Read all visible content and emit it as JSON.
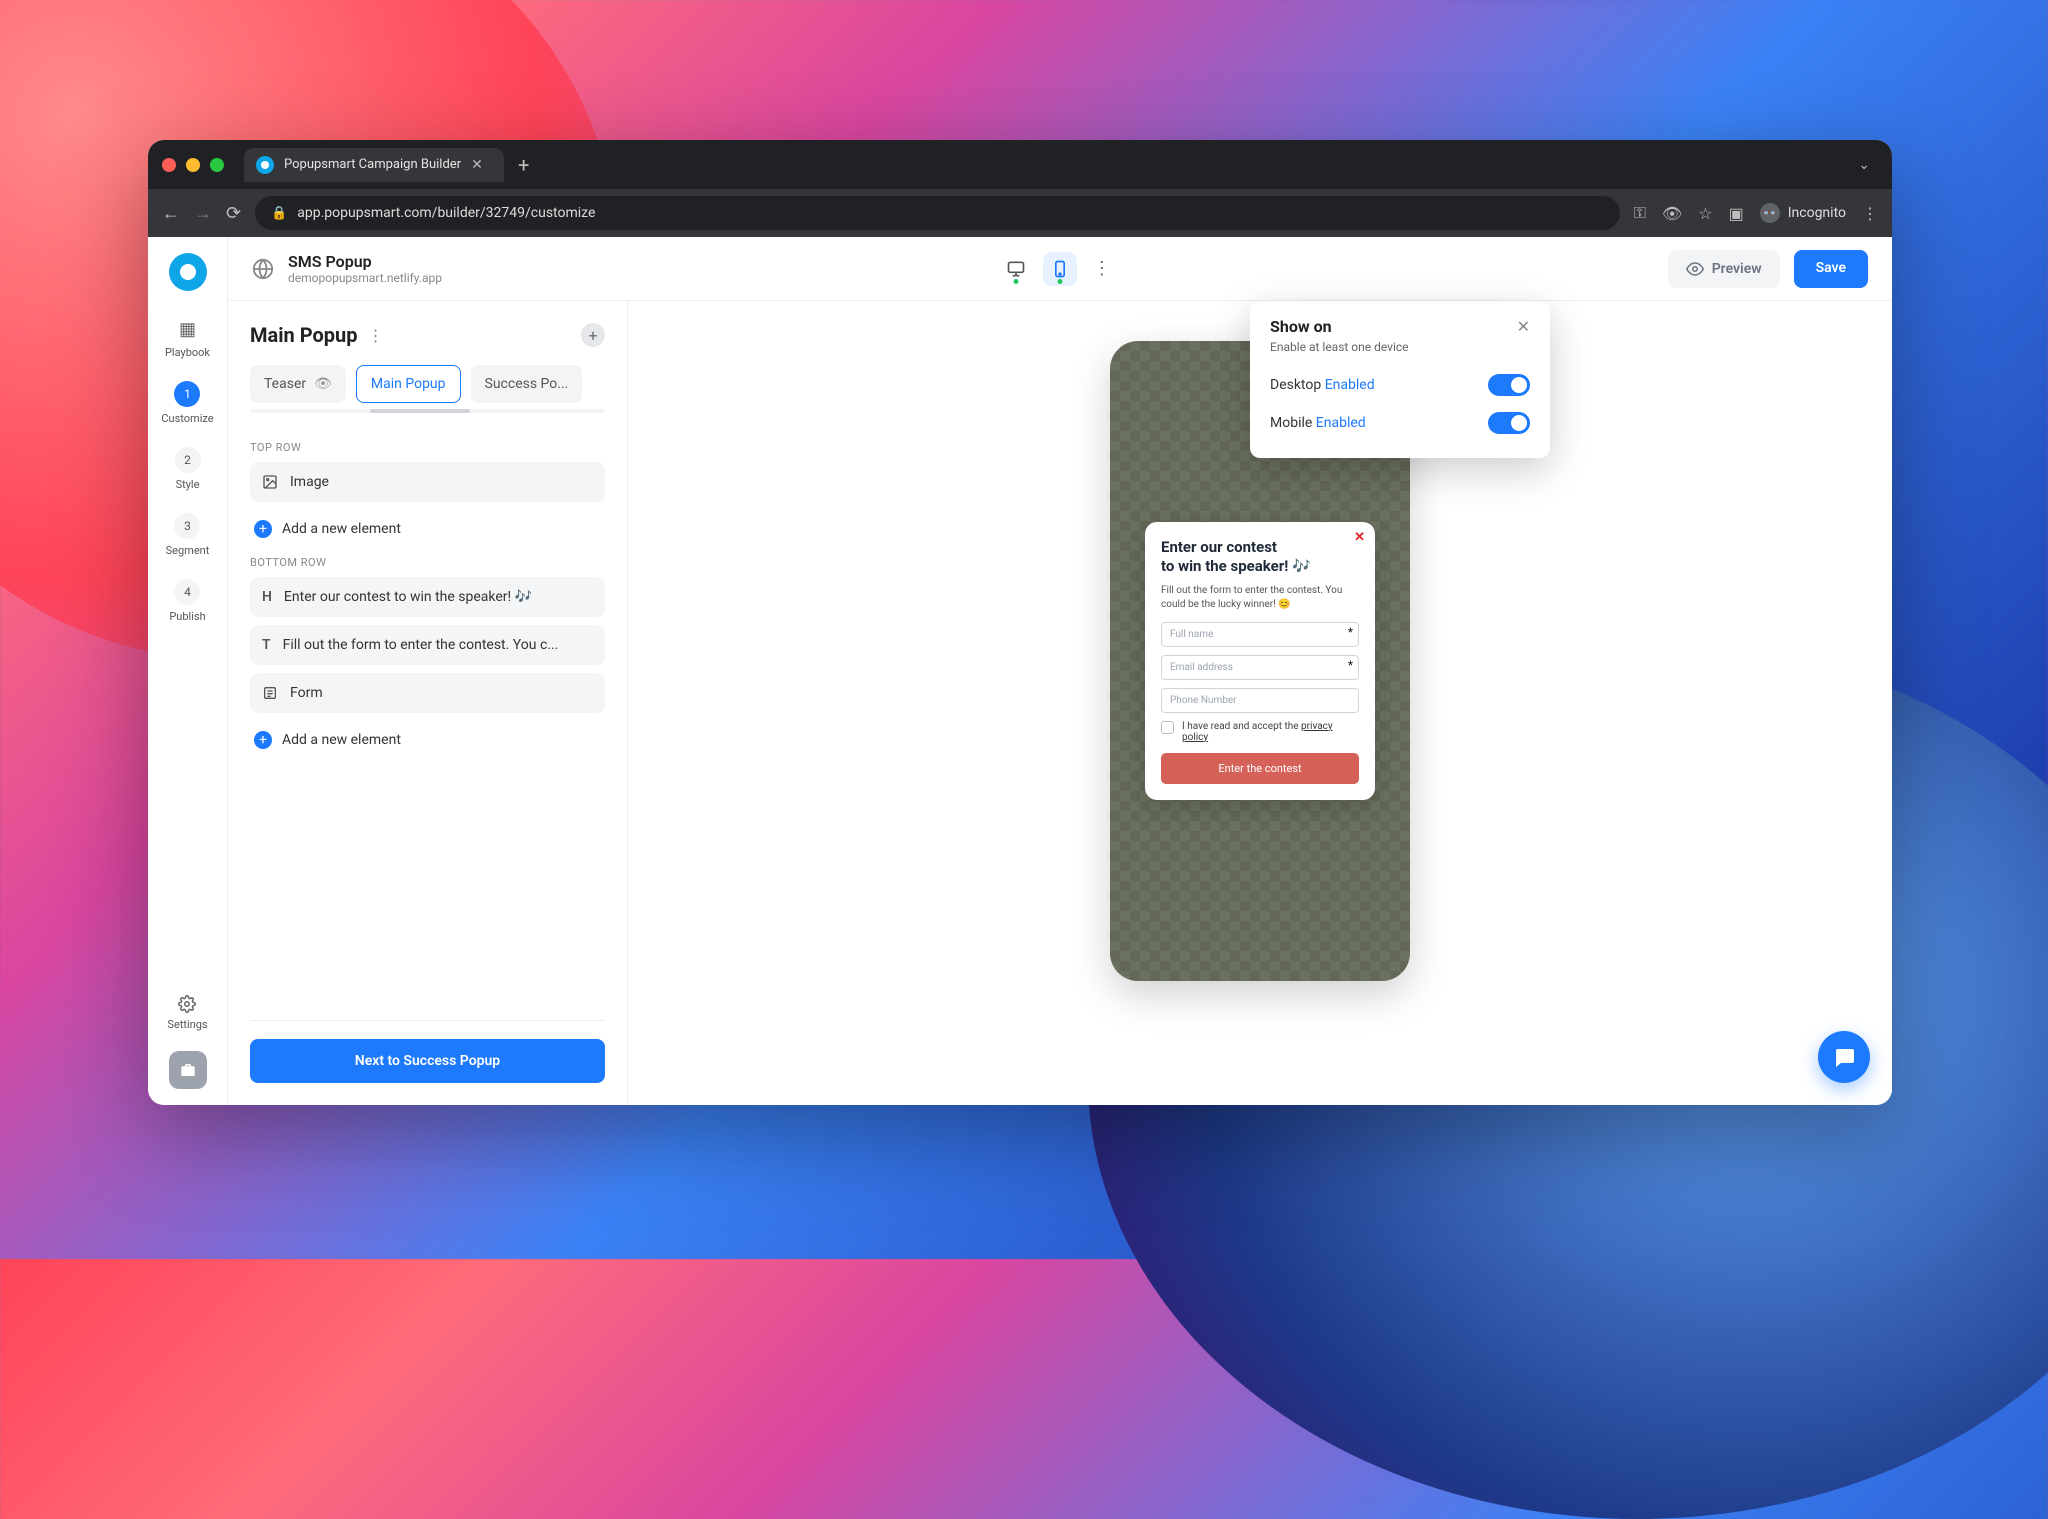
{
  "browser": {
    "tab_title": "Popupsmart Campaign Builder",
    "url": "app.popupsmart.com/builder/32749/customize",
    "incognito_label": "Incognito"
  },
  "rail": {
    "playbook": "Playbook",
    "steps": [
      {
        "num": "1",
        "label": "Customize"
      },
      {
        "num": "2",
        "label": "Style"
      },
      {
        "num": "3",
        "label": "Segment"
      },
      {
        "num": "4",
        "label": "Publish"
      }
    ],
    "settings": "Settings"
  },
  "topbar": {
    "title": "SMS Popup",
    "subtitle": "demopopupsmart.netlify.app",
    "preview": "Preview",
    "save": "Save"
  },
  "panel": {
    "title": "Main Popup",
    "tabs": {
      "teaser": "Teaser",
      "main": "Main Popup",
      "success": "Success Po..."
    },
    "top_label": "TOP ROW",
    "bottom_label": "BOTTOM ROW",
    "top_elements": [
      {
        "label": "Image"
      }
    ],
    "bottom_elements": [
      {
        "label": "Enter our contest to win the speaker! 🎶"
      },
      {
        "label": "Fill out the form to enter the contest. You c..."
      },
      {
        "label": "Form"
      }
    ],
    "add": "Add a new element",
    "next": "Next to Success Popup"
  },
  "showon": {
    "title": "Show on",
    "subtitle": "Enable at least one device",
    "desktop": "Desktop",
    "mobile": "Mobile",
    "enabled": "Enabled"
  },
  "popup": {
    "heading": "Enter our contest\nto win the speaker! 🎶",
    "text": "Fill out the form to enter the contest. You could be the lucky winner! 😊",
    "full_name": "Full name",
    "email": "Email address",
    "phone": "Phone Number",
    "consent_pre": "I have read and accept the ",
    "consent_link": "privacy policy",
    "button": "Enter the contest"
  }
}
